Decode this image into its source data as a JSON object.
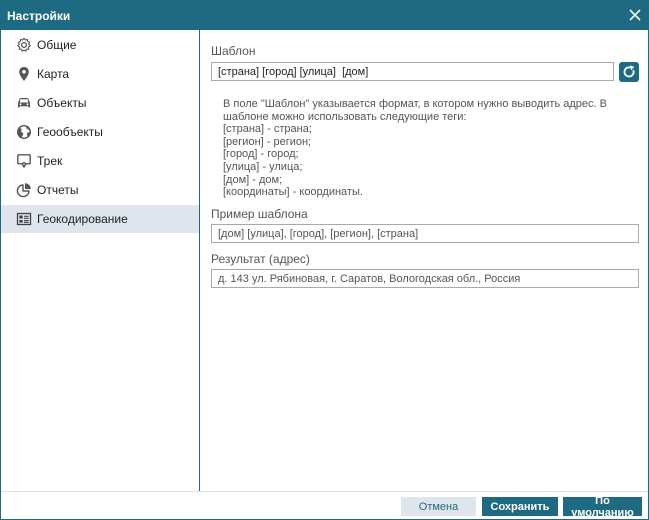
{
  "window": {
    "title": "Настройки"
  },
  "sidebar": {
    "items": [
      {
        "label": "Общие",
        "icon": "gear-icon",
        "active": false
      },
      {
        "label": "Карта",
        "icon": "map-pin-icon",
        "active": false
      },
      {
        "label": "Объекты",
        "icon": "car-icon",
        "active": false
      },
      {
        "label": "Геообъекты",
        "icon": "globe-icon",
        "active": false
      },
      {
        "label": "Трек",
        "icon": "track-icon",
        "active": false
      },
      {
        "label": "Отчеты",
        "icon": "pie-chart-icon",
        "active": false
      },
      {
        "label": "Геокодирование",
        "icon": "address-card-icon",
        "active": true
      }
    ]
  },
  "template_section": {
    "label": "Шаблон",
    "value": "[страна] [город] [улица]  [дом]"
  },
  "help_lines": [
    "В поле \"Шаблон\" указывается формат, в котором нужно выводить адрес. В",
    "шаблоне можно использовать следующие теги:",
    "[страна] - страна;",
    "[регион] - регион;",
    "[город] - город;",
    "[улица] - улица;",
    "[дом] - дом;",
    "[координаты] - координаты."
  ],
  "example_section": {
    "label": "Пример шаблона",
    "value": "[дом] [улица], [город], [регион], [страна]"
  },
  "result_section": {
    "label": "Результат (адрес)",
    "value": "д. 143 ул. Рябиновая, г. Саратов, Вологодская обл., Россия"
  },
  "footer": {
    "cancel_label": "Отмена",
    "save_label": "Сохранить",
    "default_label": "По умолчанию"
  },
  "colors": {
    "accent": "#1e6a83",
    "active_bg": "#dfe5ec"
  }
}
